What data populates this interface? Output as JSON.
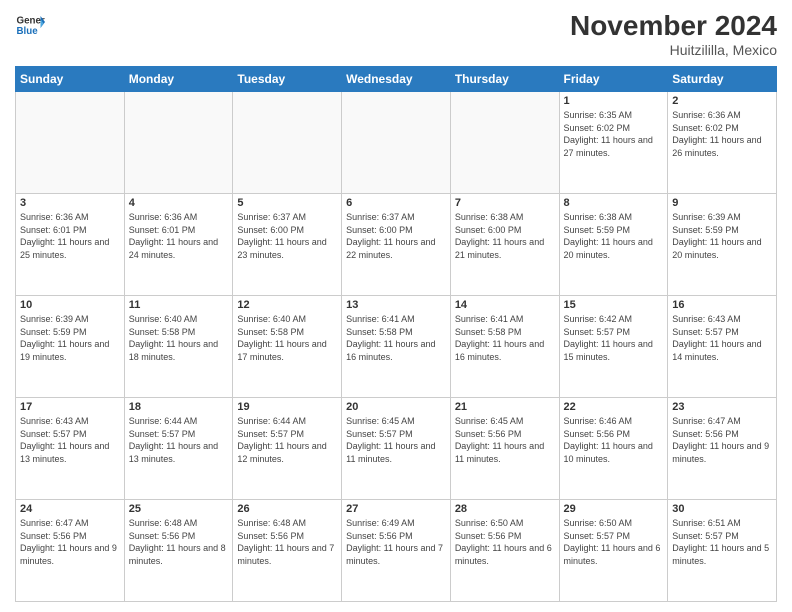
{
  "header": {
    "logo_line1": "General",
    "logo_line2": "Blue",
    "month_title": "November 2024",
    "location": "Huitzililla, Mexico"
  },
  "weekdays": [
    "Sunday",
    "Monday",
    "Tuesday",
    "Wednesday",
    "Thursday",
    "Friday",
    "Saturday"
  ],
  "weeks": [
    [
      {
        "day": "",
        "info": ""
      },
      {
        "day": "",
        "info": ""
      },
      {
        "day": "",
        "info": ""
      },
      {
        "day": "",
        "info": ""
      },
      {
        "day": "",
        "info": ""
      },
      {
        "day": "1",
        "info": "Sunrise: 6:35 AM\nSunset: 6:02 PM\nDaylight: 11 hours and 27 minutes."
      },
      {
        "day": "2",
        "info": "Sunrise: 6:36 AM\nSunset: 6:02 PM\nDaylight: 11 hours and 26 minutes."
      }
    ],
    [
      {
        "day": "3",
        "info": "Sunrise: 6:36 AM\nSunset: 6:01 PM\nDaylight: 11 hours and 25 minutes."
      },
      {
        "day": "4",
        "info": "Sunrise: 6:36 AM\nSunset: 6:01 PM\nDaylight: 11 hours and 24 minutes."
      },
      {
        "day": "5",
        "info": "Sunrise: 6:37 AM\nSunset: 6:00 PM\nDaylight: 11 hours and 23 minutes."
      },
      {
        "day": "6",
        "info": "Sunrise: 6:37 AM\nSunset: 6:00 PM\nDaylight: 11 hours and 22 minutes."
      },
      {
        "day": "7",
        "info": "Sunrise: 6:38 AM\nSunset: 6:00 PM\nDaylight: 11 hours and 21 minutes."
      },
      {
        "day": "8",
        "info": "Sunrise: 6:38 AM\nSunset: 5:59 PM\nDaylight: 11 hours and 20 minutes."
      },
      {
        "day": "9",
        "info": "Sunrise: 6:39 AM\nSunset: 5:59 PM\nDaylight: 11 hours and 20 minutes."
      }
    ],
    [
      {
        "day": "10",
        "info": "Sunrise: 6:39 AM\nSunset: 5:59 PM\nDaylight: 11 hours and 19 minutes."
      },
      {
        "day": "11",
        "info": "Sunrise: 6:40 AM\nSunset: 5:58 PM\nDaylight: 11 hours and 18 minutes."
      },
      {
        "day": "12",
        "info": "Sunrise: 6:40 AM\nSunset: 5:58 PM\nDaylight: 11 hours and 17 minutes."
      },
      {
        "day": "13",
        "info": "Sunrise: 6:41 AM\nSunset: 5:58 PM\nDaylight: 11 hours and 16 minutes."
      },
      {
        "day": "14",
        "info": "Sunrise: 6:41 AM\nSunset: 5:58 PM\nDaylight: 11 hours and 16 minutes."
      },
      {
        "day": "15",
        "info": "Sunrise: 6:42 AM\nSunset: 5:57 PM\nDaylight: 11 hours and 15 minutes."
      },
      {
        "day": "16",
        "info": "Sunrise: 6:43 AM\nSunset: 5:57 PM\nDaylight: 11 hours and 14 minutes."
      }
    ],
    [
      {
        "day": "17",
        "info": "Sunrise: 6:43 AM\nSunset: 5:57 PM\nDaylight: 11 hours and 13 minutes."
      },
      {
        "day": "18",
        "info": "Sunrise: 6:44 AM\nSunset: 5:57 PM\nDaylight: 11 hours and 13 minutes."
      },
      {
        "day": "19",
        "info": "Sunrise: 6:44 AM\nSunset: 5:57 PM\nDaylight: 11 hours and 12 minutes."
      },
      {
        "day": "20",
        "info": "Sunrise: 6:45 AM\nSunset: 5:57 PM\nDaylight: 11 hours and 11 minutes."
      },
      {
        "day": "21",
        "info": "Sunrise: 6:45 AM\nSunset: 5:56 PM\nDaylight: 11 hours and 11 minutes."
      },
      {
        "day": "22",
        "info": "Sunrise: 6:46 AM\nSunset: 5:56 PM\nDaylight: 11 hours and 10 minutes."
      },
      {
        "day": "23",
        "info": "Sunrise: 6:47 AM\nSunset: 5:56 PM\nDaylight: 11 hours and 9 minutes."
      }
    ],
    [
      {
        "day": "24",
        "info": "Sunrise: 6:47 AM\nSunset: 5:56 PM\nDaylight: 11 hours and 9 minutes."
      },
      {
        "day": "25",
        "info": "Sunrise: 6:48 AM\nSunset: 5:56 PM\nDaylight: 11 hours and 8 minutes."
      },
      {
        "day": "26",
        "info": "Sunrise: 6:48 AM\nSunset: 5:56 PM\nDaylight: 11 hours and 7 minutes."
      },
      {
        "day": "27",
        "info": "Sunrise: 6:49 AM\nSunset: 5:56 PM\nDaylight: 11 hours and 7 minutes."
      },
      {
        "day": "28",
        "info": "Sunrise: 6:50 AM\nSunset: 5:56 PM\nDaylight: 11 hours and 6 minutes."
      },
      {
        "day": "29",
        "info": "Sunrise: 6:50 AM\nSunset: 5:57 PM\nDaylight: 11 hours and 6 minutes."
      },
      {
        "day": "30",
        "info": "Sunrise: 6:51 AM\nSunset: 5:57 PM\nDaylight: 11 hours and 5 minutes."
      }
    ]
  ]
}
